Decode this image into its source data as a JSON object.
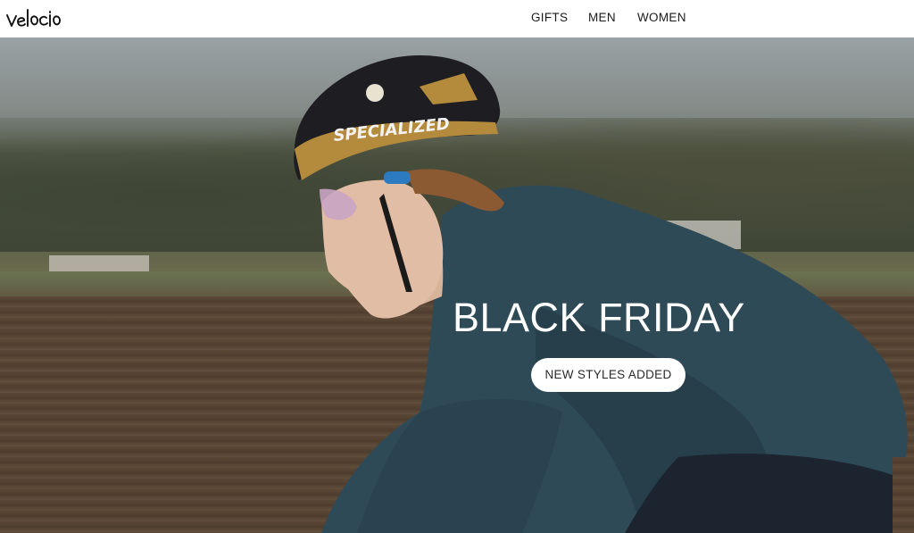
{
  "brand": {
    "logo_text": "velocio"
  },
  "nav": {
    "items": [
      {
        "label": "GIFTS"
      },
      {
        "label": "MEN"
      },
      {
        "label": "WOMEN"
      }
    ]
  },
  "hero": {
    "headline": "BLACK FRIDAY",
    "cta_label": "NEW STYLES ADDED",
    "helmet_text": "SPECIALIZED"
  },
  "colors": {
    "nav_background": "#ffffff",
    "nav_text": "#1b1b1b",
    "headline_text": "#ffffff",
    "cta_background": "#ffffff",
    "cta_text": "#2a2a2a",
    "jacket": "#2f4a57"
  }
}
